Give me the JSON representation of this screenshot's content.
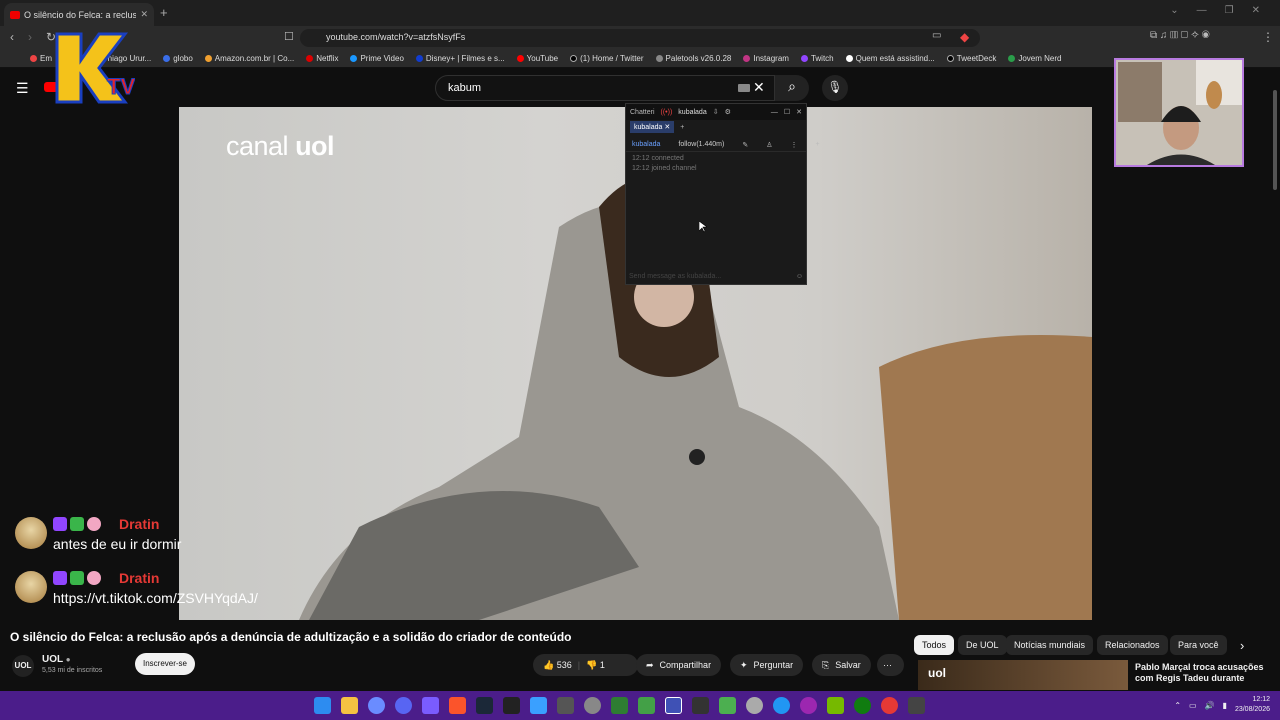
{
  "browser": {
    "tab_title": "O silêncio do Felca: a reclusã",
    "url": "youtube.com/watch?v=atzfsNsyfFs",
    "bookmarks": [
      "Em",
      "Email – Thiago Urur...",
      "globo",
      "Amazon.com.br | Co...",
      "Netflix",
      "Prime Video",
      "Disney+ | Filmes e s...",
      "YouTube",
      "(1) Home / Twitter",
      "Paletools v26.0.28",
      "Instagram",
      "Twitch",
      "Quem está assistind...",
      "TweetDeck",
      "Jovem Nerd"
    ]
  },
  "youtube": {
    "search_value": "kabum",
    "video_watermark_bold": "canal ",
    "video_watermark_light": "uol",
    "video_title": "O silêncio do Felca: a reclusão após a denúncia de adultização e a solidão do criador de conteúdo",
    "channel_name": "UOL",
    "channel_avatar": "UOL",
    "subscribers": "5,53 mi de inscritos",
    "subscribe_label": "Inscrever-se",
    "likes": "536",
    "dislikes": "1",
    "share_label": "Compartilhar",
    "ask_label": "Perguntar",
    "save_label": "Salvar",
    "more_label": "···",
    "chips": [
      "Todos",
      "De UOL",
      "Notícias mundiais",
      "Relacionados",
      "Para você"
    ],
    "related_title": "Pablo Marçal troca acusações com Regis Tadeu durante"
  },
  "chatterino": {
    "app": "Chatteri",
    "channel": "kubalada",
    "tab": "kubalada",
    "user": "kubalada",
    "follow": "follow(1.440m)",
    "lines": [
      "12:12 connected",
      "12:12 joined channel"
    ],
    "input_placeholder": "Send message as kubalada..."
  },
  "stream_chat": [
    {
      "name": "Dratin",
      "message": "antes de eu ir dormir"
    },
    {
      "name": "Dratin",
      "message": "https://vt.tiktok.com/ZSVHYqdAJ/"
    }
  ],
  "taskbar": {
    "time": "12:12",
    "date": "23/08/2026"
  },
  "colors": {
    "taskbar": "#4b1d8a",
    "chat_name": "#e53935",
    "webcam_border": "#b87be0"
  }
}
